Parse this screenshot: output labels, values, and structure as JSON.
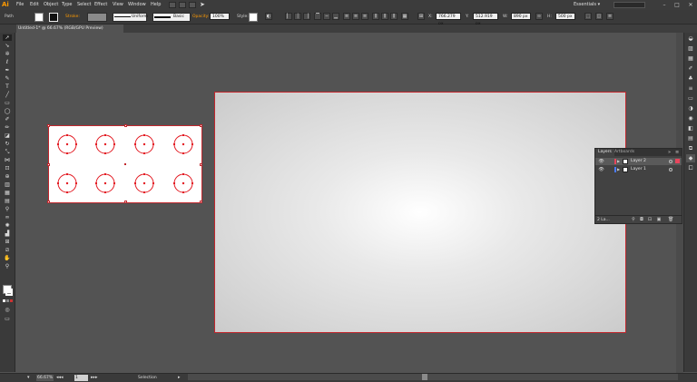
{
  "app": {
    "logo": "Ai",
    "workspace": "Essentials ▾"
  },
  "menu": [
    "File",
    "Edit",
    "Object",
    "Type",
    "Select",
    "Effect",
    "View",
    "Window",
    "Help"
  ],
  "control_bar": {
    "object_type": "Path",
    "stroke_label": "Stroke:",
    "profile_label": "Uniform",
    "brush_label": "Basic",
    "opacity_label": "Opacity:",
    "opacity_value": "100%",
    "style_label": "Style:",
    "x_value": "766.279 px",
    "y_value": "512.919 px",
    "w_value": "890 px",
    "h_value": "500 px",
    "x_label": "X:",
    "y_label": "Y:",
    "w_label": "W:",
    "h_label": "H:"
  },
  "document_tab": "Untitled-1* @ 66.67% (RGB/GPU Preview)",
  "layers_panel": {
    "tabs": [
      "Layers",
      "Artboards"
    ],
    "layers": [
      {
        "name": "Layer 2",
        "color": "#e8455c",
        "selected": true
      },
      {
        "name": "Layer 1",
        "color": "#4a7bff",
        "selected": false
      }
    ],
    "footer_text": "2 La..."
  },
  "status_bar": {
    "zoom": "66.67%",
    "artboard_index": "1",
    "tool_status": "Selection"
  },
  "colors": {
    "accent": "#c1272d",
    "logo": "#ff9a00"
  }
}
